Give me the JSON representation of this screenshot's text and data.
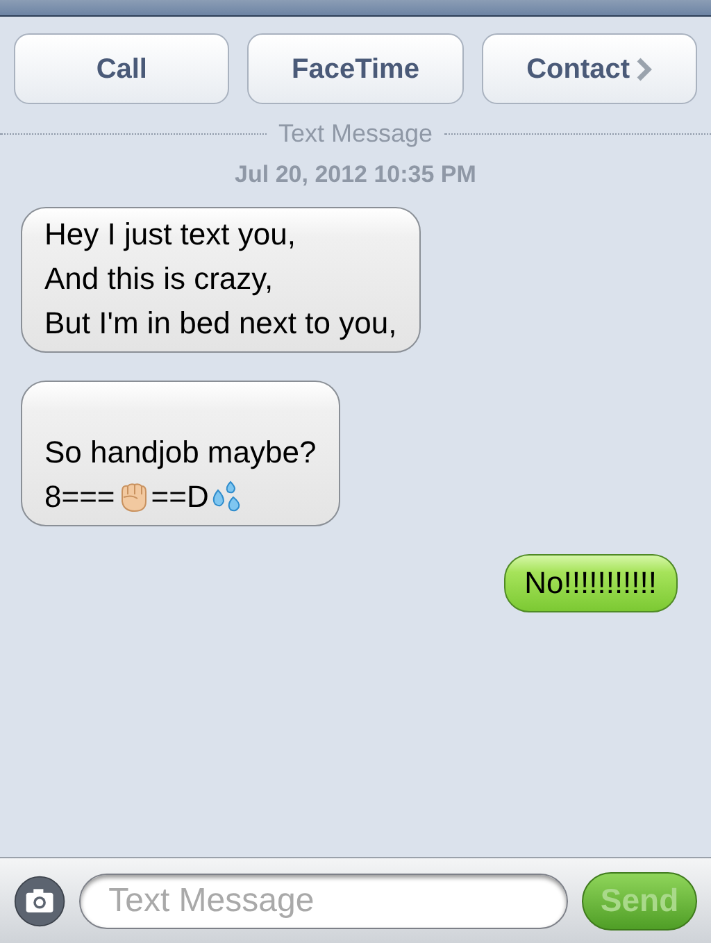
{
  "actions": [
    {
      "label": "Call",
      "chevron": false
    },
    {
      "label": "FaceTime",
      "chevron": false
    },
    {
      "label": "Contact",
      "chevron": true
    }
  ],
  "divider": {
    "label": "Text Message",
    "timestamp": "Jul 20, 2012 10:35 PM"
  },
  "messages": [
    {
      "outgoing": false,
      "lines": [
        [
          {
            "kind": "text",
            "text": "Hey I just text you,"
          }
        ],
        [
          {
            "kind": "text",
            "text": "And this is crazy,"
          }
        ],
        [
          {
            "kind": "text",
            "text": "But I'm in bed next to you,"
          }
        ]
      ]
    },
    {
      "outgoing": false,
      "leading_blank_line": true,
      "lines": [
        [
          {
            "kind": "text",
            "text": "So handjob maybe?"
          }
        ],
        [
          {
            "kind": "text",
            "text": "8==="
          },
          {
            "kind": "hand-emoji"
          },
          {
            "kind": "text",
            "text": "==D"
          },
          {
            "kind": "drops-emoji"
          }
        ]
      ]
    },
    {
      "outgoing": true,
      "lines": [
        [
          {
            "kind": "text",
            "text": "No!!!!!!!!!!!"
          }
        ]
      ]
    }
  ],
  "composer": {
    "placeholder": "Text Message",
    "send": {
      "label": "Send",
      "disabled": true
    }
  }
}
